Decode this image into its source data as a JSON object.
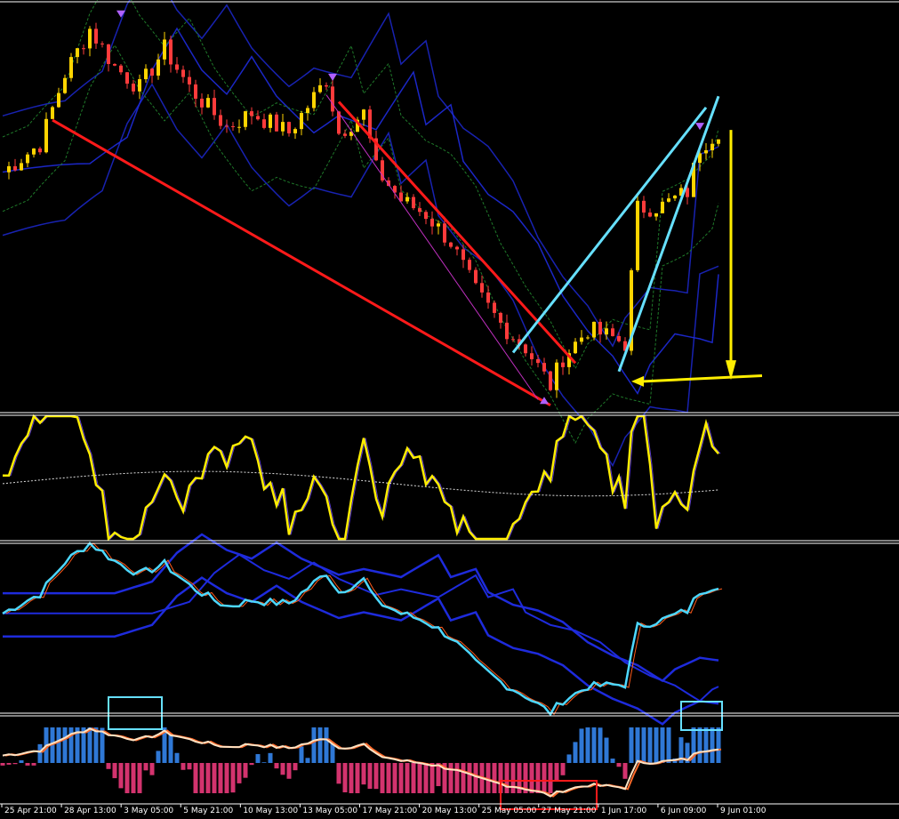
{
  "chart_data": {
    "type": "line",
    "colors": {
      "background": "#000000",
      "separator": "#ffffff",
      "bull_candle": "#ffd400",
      "bear_candle": "#ff3b3b",
      "rsi_line": "#ffee00",
      "osc_line": "#4dd8ff",
      "band_blue": "#1e2bdc",
      "trend_red": "#ff1a1a",
      "trend_cyan": "#66e0ff",
      "arrow_yellow": "#ffee00",
      "hist_pos": "#2f78d6",
      "hist_neg": "#d3336e",
      "box_cyan": "#66e0ff",
      "box_red": "#ff1a1a"
    },
    "x_axis": {
      "tick_labels": [
        "25 Apr 21:00",
        "28 Apr 13:00",
        "3 May 05:00",
        "5 May 21:00",
        "10 May 13:00",
        "13 May 05:00",
        "17 May 21:00",
        "20 May 13:00",
        "25 May 05:00",
        "27 May 21:00",
        "1 Jun 17:00",
        "6 Jun 09:00",
        "9 Jun 01:00"
      ]
    },
    "panels": [
      {
        "name": "price",
        "type": "candlestick",
        "trendlines": [
          {
            "color": "red",
            "from_index": 8,
            "to_index": 88,
            "direction": "down"
          },
          {
            "color": "red",
            "from_index": 54,
            "to_index": 92,
            "direction": "down"
          },
          {
            "color": "cyan",
            "from_index": 82,
            "to_index": 113,
            "direction": "up"
          },
          {
            "color": "cyan",
            "from_index": 99,
            "to_index": 115,
            "direction": "up"
          }
        ],
        "annotations": [
          "down-arrow",
          "down-arrow",
          "up-arrow",
          "down-arrow"
        ]
      },
      {
        "name": "oscillator-1",
        "type": "line"
      },
      {
        "name": "oscillator-2",
        "type": "line"
      },
      {
        "name": "histogram",
        "type": "bar",
        "highlight_boxes": [
          "cyan-left",
          "red-bottom",
          "cyan-right"
        ]
      }
    ],
    "series_count": 116
  }
}
